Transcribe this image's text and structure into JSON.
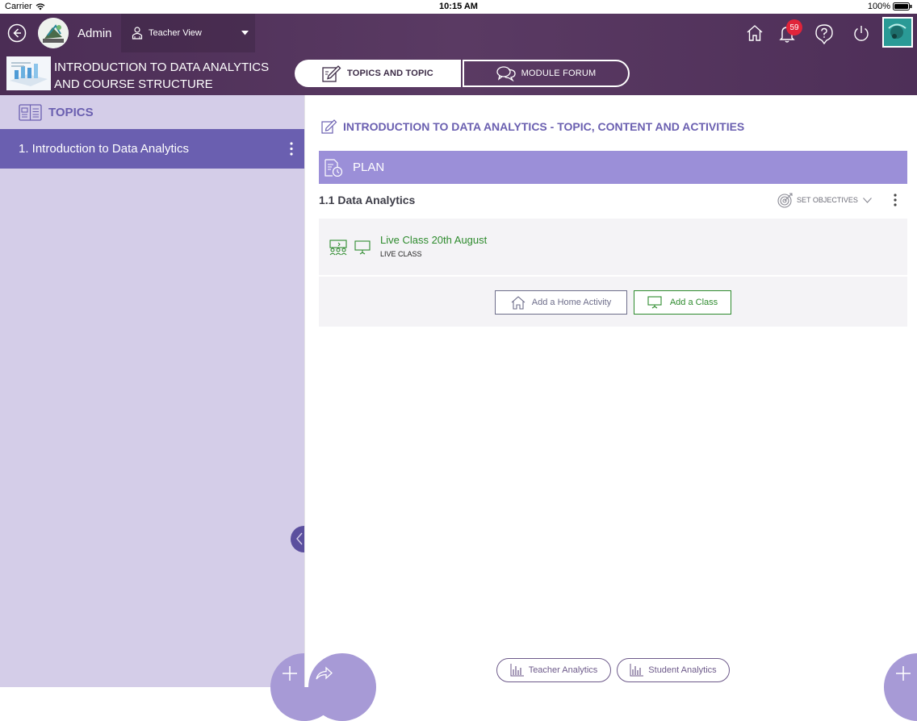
{
  "status_bar": {
    "carrier": "Carrier",
    "time": "10:15 AM",
    "battery": "100%"
  },
  "header": {
    "user_name": "Admin",
    "view_selector": "Teacher View",
    "notification_count": "59",
    "course_title": "INTRODUCTION TO DATA ANALYTICS AND COURSE STRUCTURE",
    "tabs": [
      {
        "label": "TOPICS AND TOPIC",
        "active": true
      },
      {
        "label": "MODULE FORUM",
        "active": false
      }
    ]
  },
  "sidebar": {
    "heading": "TOPICS",
    "items": [
      {
        "label": "1.  Introduction to Data Analytics"
      }
    ]
  },
  "main": {
    "title": "INTRODUCTION TO DATA ANALYTICS - TOPIC, CONTENT AND ACTIVITIES",
    "plan_label": "PLAN",
    "section_title": "1.1 Data Analytics",
    "set_objectives": "SET OBJECTIVES",
    "activity": {
      "title": "Live Class 20th August",
      "type": "LIVE CLASS"
    },
    "add_home_activity": "Add a Home Activity",
    "add_class": "Add a Class"
  },
  "footer": {
    "teacher_analytics": "Teacher Analytics",
    "student_analytics": "Student Analytics"
  },
  "colors": {
    "header_bg": "#4e2f58",
    "accent_purple": "#6a5fb0",
    "plan_purple": "#9b8fd8",
    "sidebar_bg": "#d4cde8",
    "green": "#2e8b2e",
    "badge_red": "#e0243a",
    "fab": "#a79ad6"
  },
  "icons": [
    "back-icon",
    "avatar",
    "teacher-icon",
    "dropdown-icon",
    "home-icon",
    "bell-icon",
    "help-icon",
    "power-icon",
    "profile-icon",
    "course-thumbnail",
    "edit-icon",
    "chat-icon",
    "topics-icon",
    "more-icon",
    "plan-icon",
    "target-icon",
    "chevron-down-icon",
    "group-icon",
    "presentation-icon",
    "house-icon",
    "bar-chart-icon",
    "plus-icon",
    "share-icon",
    "collapse-icon"
  ]
}
